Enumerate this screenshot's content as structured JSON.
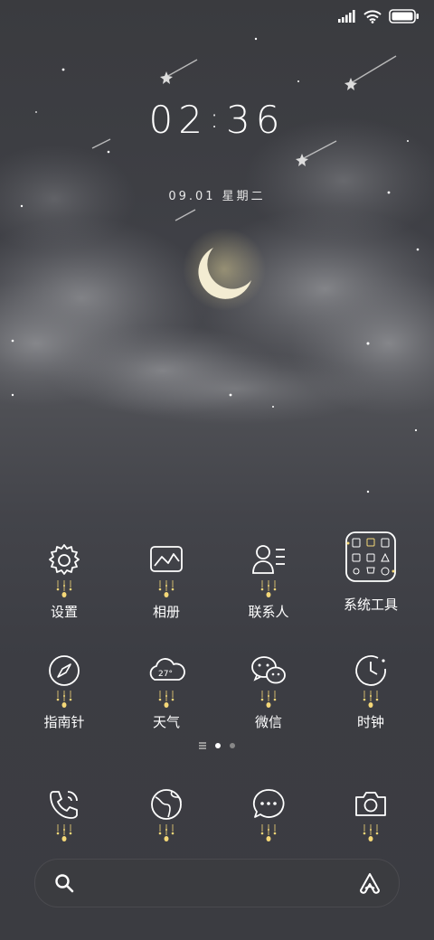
{
  "status_bar": {
    "signal_icon": "signal-icon",
    "wifi_icon": "wifi-icon",
    "battery_icon": "battery-icon"
  },
  "lock": {
    "hour": "02",
    "separator": ":",
    "minute": "36",
    "date": "09.01 星期二"
  },
  "apps_row1": [
    {
      "label": "设置",
      "icon": "gear-icon"
    },
    {
      "label": "相册",
      "icon": "gallery-icon"
    },
    {
      "label": "联系人",
      "icon": "contacts-icon"
    },
    {
      "label": "系统工具",
      "icon": "folder-icon"
    }
  ],
  "apps_row2": [
    {
      "label": "指南针",
      "icon": "compass-icon"
    },
    {
      "label": "天气",
      "icon": "weather-icon",
      "temp": "27°"
    },
    {
      "label": "微信",
      "icon": "wechat-icon"
    },
    {
      "label": "时钟",
      "icon": "clock-icon"
    }
  ],
  "dock": [
    {
      "icon": "phone-icon"
    },
    {
      "icon": "browser-icon"
    },
    {
      "icon": "messages-icon"
    },
    {
      "icon": "camera-icon"
    }
  ],
  "page_indicator": {
    "pages": 2,
    "current": 1
  },
  "search": {
    "placeholder": ""
  },
  "colors": {
    "background": "#3e3f45",
    "moon": "#f3ecd2",
    "drip": "#f5d878"
  }
}
